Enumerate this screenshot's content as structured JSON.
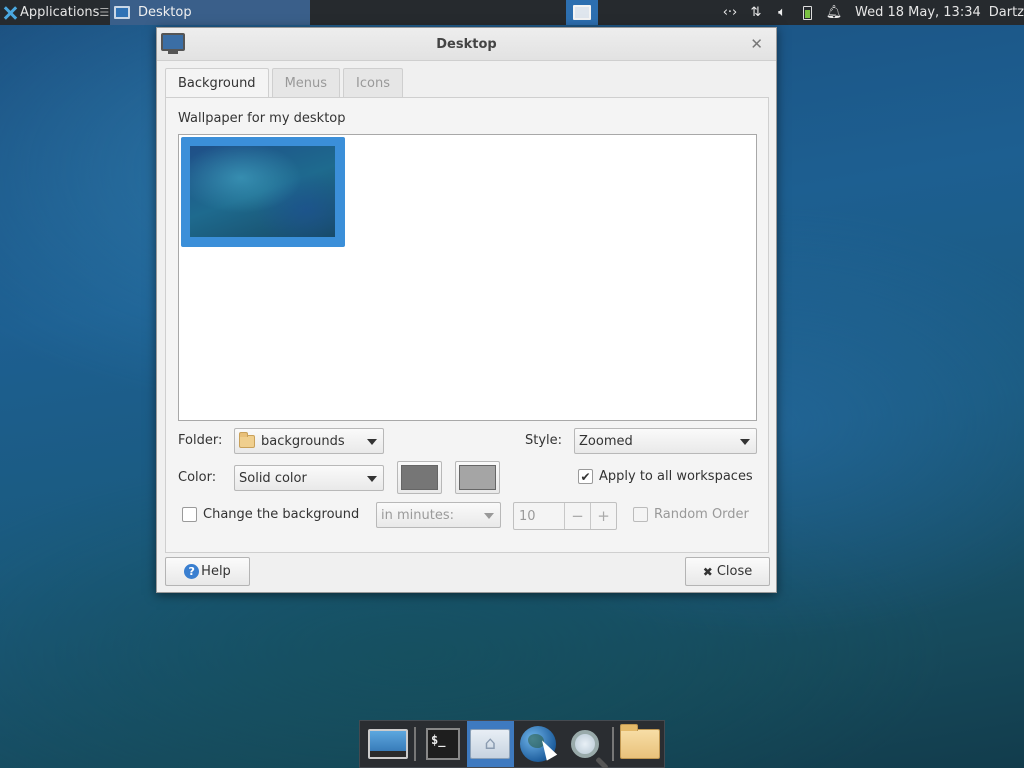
{
  "top_panel": {
    "applications_label": "Applications",
    "menu_glyph": "☰",
    "task_label": "Desktop",
    "clock": "Wed 18 May, 13:34",
    "user": "Dartz",
    "icons": [
      "network-icon",
      "transfer-icon",
      "volume-icon",
      "battery-icon",
      "notification-icon"
    ]
  },
  "dialog": {
    "title": "Desktop",
    "tabs": [
      {
        "label": "Background",
        "active": true
      },
      {
        "label": "Menus",
        "active": false
      },
      {
        "label": "Icons",
        "active": false
      }
    ],
    "wallpaper_label": "Wallpaper for my desktop",
    "folder_label": "Folder:",
    "folder_value": "backgrounds",
    "style_label": "Style:",
    "style_value": "Zoomed",
    "color_label": "Color:",
    "color_value": "Solid color",
    "color1": "#767676",
    "color2": "#a5a5a5",
    "apply_all_label": "Apply to all workspaces",
    "apply_all_checked": true,
    "change_bg_label": "Change the background",
    "change_bg_checked": false,
    "interval_unit": "in minutes:",
    "interval_value": "10",
    "random_label": "Random Order",
    "random_checked": false,
    "help_label": "Help",
    "close_label": "Close"
  },
  "dock": {
    "items": [
      "show-desktop-icon",
      "terminal-icon",
      "home-folder-icon",
      "web-browser-icon",
      "app-finder-icon",
      "file-manager-icon"
    ],
    "terminal_glyph": "$_"
  },
  "colors": {
    "accent": "#3b8fd9",
    "panel": "#262a2e"
  }
}
